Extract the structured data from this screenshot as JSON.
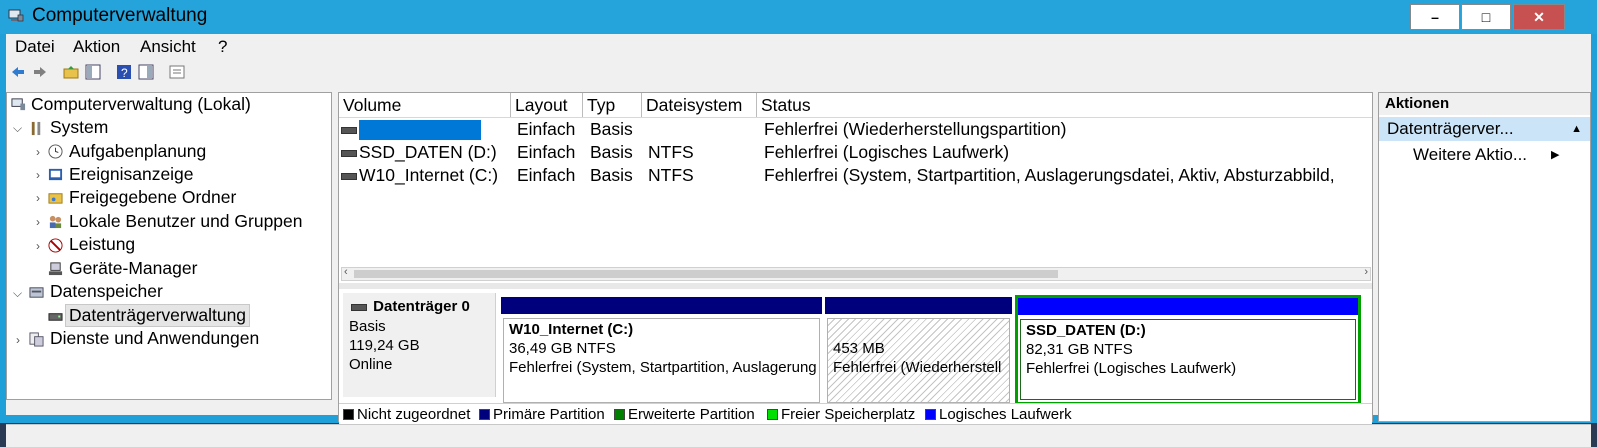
{
  "window": {
    "title": "Computerverwaltung"
  },
  "menu": [
    "Datei",
    "Aktion",
    "Ansicht",
    "?"
  ],
  "toolbar_icons": [
    "back-arrow-icon",
    "forward-arrow-icon",
    "up-folder-icon",
    "show-hide-tree-icon",
    "help-icon",
    "show-hide-action-pane-icon",
    "properties-icon"
  ],
  "tree": {
    "root": "Computerverwaltung (Lokal)",
    "system": "System",
    "aufgabenplanung": "Aufgabenplanung",
    "ereignisanzeige": "Ereignisanzeige",
    "freigegebene": "Freigegebene Ordner",
    "benutzer": "Lokale Benutzer und Gruppen",
    "leistung": "Leistung",
    "geraete": "Geräte-Manager",
    "datenspeicher": "Datenspeicher",
    "datentraeger": "Datenträgerverwaltung",
    "dienste": "Dienste und Anwendungen"
  },
  "volumes": {
    "columns": [
      "Volume",
      "Layout",
      "Typ",
      "Dateisystem",
      "Status"
    ],
    "rows": [
      {
        "volume": "",
        "layout": "Einfach",
        "typ": "Basis",
        "fs": "",
        "status": "Fehlerfrei (Wiederherstellungspartition)"
      },
      {
        "volume": "SSD_DATEN (D:)",
        "layout": "Einfach",
        "typ": "Basis",
        "fs": "NTFS",
        "status": "Fehlerfrei (Logisches Laufwerk)"
      },
      {
        "volume": "W10_Internet (C:)",
        "layout": "Einfach",
        "typ": "Basis",
        "fs": "NTFS",
        "status": "Fehlerfrei (System, Startpartition, Auslagerungsdatei, Aktiv, Absturzabbild,"
      }
    ]
  },
  "disk": {
    "name": "Datenträger 0",
    "type": "Basis",
    "size": "119,24 GB",
    "state": "Online",
    "partitions": [
      {
        "name": "W10_Internet  (C:)",
        "size": "36,49 GB NTFS",
        "status": "Fehlerfrei (System, Startpartition, Auslagerung"
      },
      {
        "name": "",
        "size": "453 MB",
        "status": "Fehlerfrei (Wiederherstell"
      },
      {
        "name": "SSD_DATEN  (D:)",
        "size": "82,31 GB NTFS",
        "status": "Fehlerfrei (Logisches Laufwerk)"
      }
    ]
  },
  "legend": [
    {
      "label": "Nicht zugeordnet",
      "color": "#000000"
    },
    {
      "label": "Primäre Partition",
      "color": "#00007c"
    },
    {
      "label": "Erweiterte Partition",
      "color": "#008000"
    },
    {
      "label": "Freier Speicherplatz",
      "color": "#00e000"
    },
    {
      "label": "Logisches Laufwerk",
      "color": "#0000ff"
    }
  ],
  "actions": {
    "header": "Aktionen",
    "selected": "Datenträgerver...",
    "more": "Weitere Aktio..."
  },
  "colors": {
    "titlebar": "#25a4dc",
    "primary": "#00007c",
    "logical": "#0000ff",
    "extended": "#008000",
    "redacted": "#0078d7"
  }
}
